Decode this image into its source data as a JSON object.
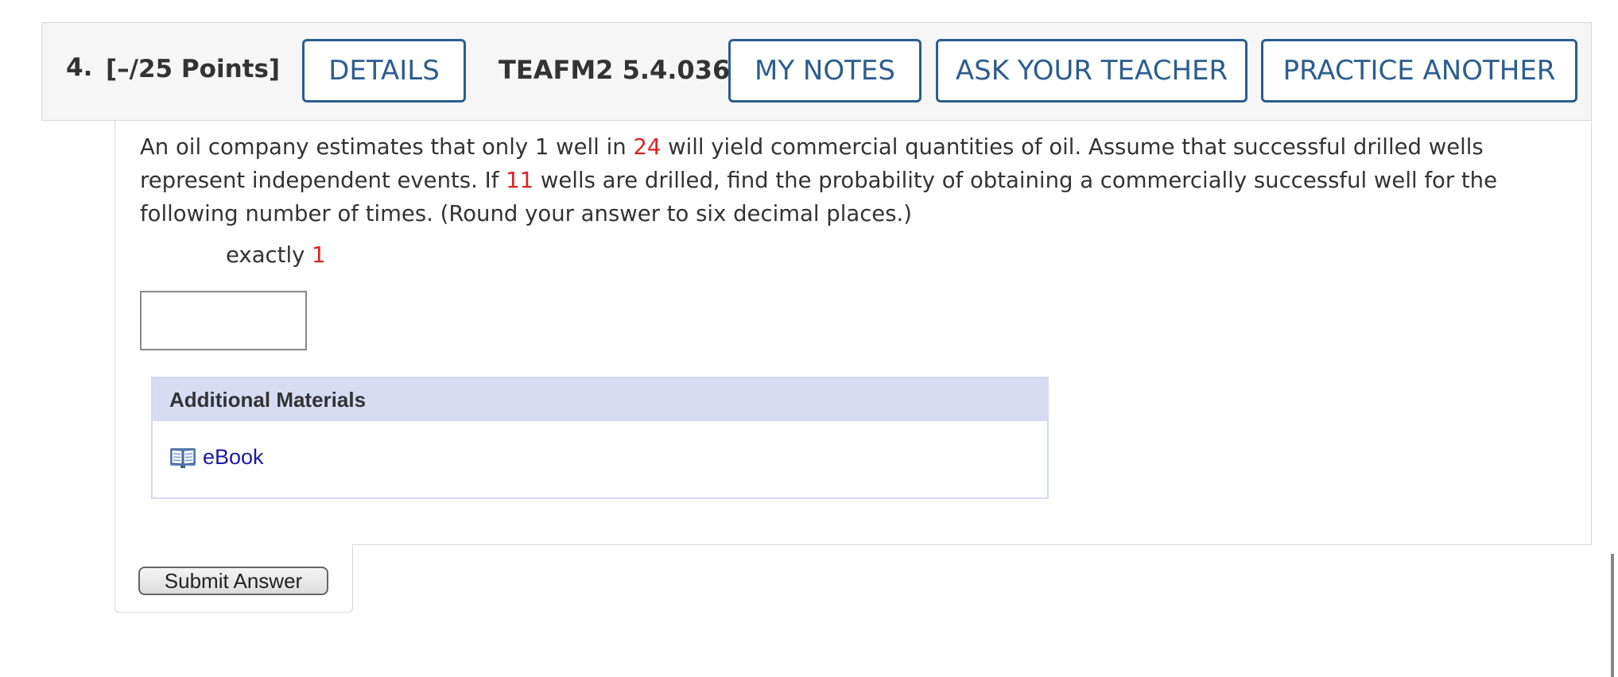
{
  "question_header": {
    "number": "4.",
    "points": "[–/25 Points]",
    "details_label": "DETAILS",
    "code": "TEAFM2 5.4.036.",
    "my_notes_label": "MY NOTES",
    "ask_teacher_label": "ASK YOUR TEACHER",
    "practice_label": "PRACTICE ANOTHER"
  },
  "question": {
    "text_1": "An oil company estimates that only 1 well in ",
    "value_1": "24",
    "text_2": " will yield commercial quantities of oil. Assume that successful drilled wells represent independent events. If ",
    "value_2": "11",
    "text_3": " wells are drilled, find the probability of obtaining a commercially successful well for the following number of times. (Round your answer to six decimal places.)",
    "part_label": "exactly ",
    "part_value": "1",
    "answer_value": ""
  },
  "materials": {
    "heading": "Additional Materials",
    "ebook_label": "eBook"
  },
  "submit_label": "Submit Answer",
  "colors": {
    "accent_blue": "#2c5d8f",
    "variable_red": "#dd2222",
    "link_blue": "#1a1aa6",
    "materials_header": "#d7dcf3"
  }
}
